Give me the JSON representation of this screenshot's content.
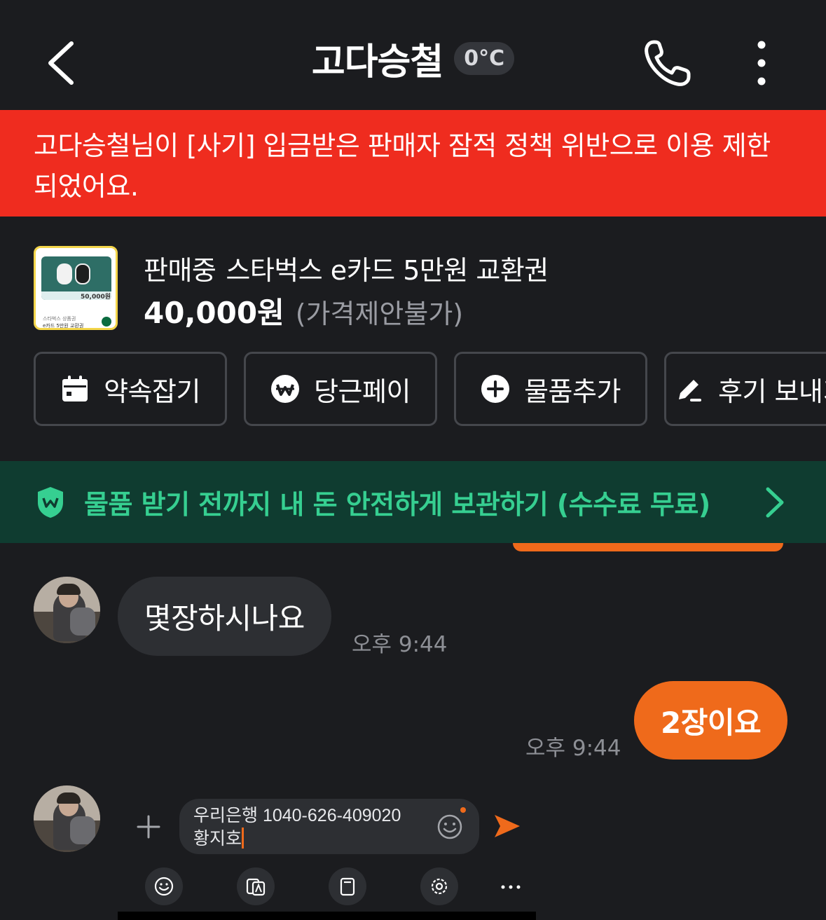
{
  "header": {
    "title": "고다승철",
    "temperature": "0°C",
    "icons": {
      "back": "chevron-left-icon",
      "call": "phone-icon",
      "more": "more-vertical-icon"
    }
  },
  "warning_banner": {
    "text": "고다승철님이 [사기] 입금받은 판매자 잠적 정책 위반으로 이용 제한되었어요.",
    "color": "#ef2c1f"
  },
  "product": {
    "status": "판매중",
    "name": "스타벅스 e카드 5만원 교환권",
    "price": "40,000원",
    "price_note": "(가격제안불가)",
    "thumbnail": {
      "price": "50,000원",
      "line1": "스타벅스 상품권",
      "line2": "e카드 5만원 교환권"
    }
  },
  "actions": [
    {
      "label": "약속잡기",
      "icon": "calendar-icon"
    },
    {
      "label": "당근페이",
      "icon": "won-pay-icon"
    },
    {
      "label": "물품추가",
      "icon": "plus-circle-icon"
    },
    {
      "label": "후기 보내기",
      "icon": "pencil-icon"
    }
  ],
  "safe_payment": {
    "text": "물품 받기 전까지 내 돈 안전하게 보관하기 (수수료 무료)",
    "color": "#36cf91",
    "icon": "shield-won-icon"
  },
  "messages": [
    {
      "direction": "incoming",
      "text": "몇장하시나요",
      "time": "오후 9:44"
    },
    {
      "direction": "outgoing",
      "text": "2장이요",
      "time": "오후 9:44"
    }
  ],
  "composer": {
    "value": "우리은행 1040-626-409020\n황지호",
    "icons": {
      "add": "plus-icon",
      "emoji": "smiley-icon",
      "send": "send-icon"
    }
  },
  "keyboard_toolbar": [
    "emoji-icon",
    "translate-icon",
    "clipboard-icon",
    "settings-icon",
    "more-horizontal-icon"
  ],
  "colors": {
    "accent": "#ef6a1b",
    "background": "#1b1c1f",
    "bubble_incoming": "#2d2f33"
  }
}
